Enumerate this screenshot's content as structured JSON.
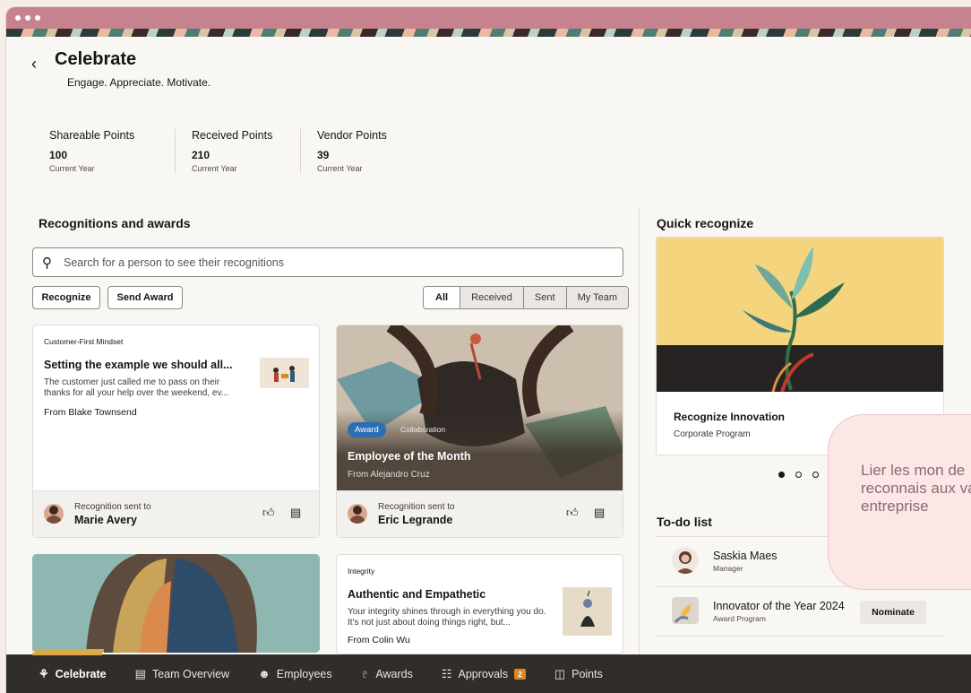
{
  "header": {
    "title": "Celebrate",
    "subtitle": "Engage. Appreciate. Motivate."
  },
  "points": [
    {
      "label": "Shareable Points",
      "value": "100",
      "period": "Current Year"
    },
    {
      "label": "Received Points",
      "value": "210",
      "period": "Current Year"
    },
    {
      "label": "Vendor Points",
      "value": "39",
      "period": "Current Year"
    }
  ],
  "recognitions": {
    "title": "Recognitions and awards",
    "search_placeholder": "Search for a person to see their recognitions",
    "recognize_label": "Recognize",
    "send_award_label": "Send Award",
    "filters": [
      "All",
      "Received",
      "Sent",
      "My Team"
    ],
    "cards": [
      {
        "tag": "Customer-First Mindset",
        "title": "Setting the example we should all...",
        "desc": "The customer just called me to pass on their thanks for all your help over the weekend, ev...",
        "from": "From Blake Townsend",
        "sent_label": "Recognition sent to",
        "recipient": "Marie Avery"
      },
      {
        "badge": "Award",
        "category": "Collaboration",
        "title": "Employee of the Month",
        "from": "From Alejandro Cruz",
        "sent_label": "Recognition sent to",
        "recipient": "Eric Legrande"
      },
      {
        "tag": "Integrity",
        "title": "Authentic and Empathetic",
        "desc": "Your integrity shines through in everything you do. It's not just about doing things right, but...",
        "from": "From Colin Wu"
      }
    ]
  },
  "quick_recognize": {
    "title": "Quick recognize",
    "card_title": "Recognize Innovation",
    "card_sub": "Corporate Program"
  },
  "todo": {
    "title": "To-do list",
    "items": [
      {
        "name": "Saskia Maes",
        "role": "Manager"
      },
      {
        "name": "Innovator of the Year 2024",
        "role": "Award Program",
        "action": "Nominate"
      }
    ]
  },
  "tooltip": {
    "text": "Lier les mon de reconnais aux valeurs entreprise"
  },
  "nav": {
    "items": [
      "Celebrate",
      "Team Overview",
      "Employees",
      "Awards",
      "Approvals",
      "Points"
    ],
    "approvals_count": "2"
  },
  "colors": {
    "titlebar": "#c6828f",
    "nav_bg": "#312d2a",
    "award_badge": "#2a6fb3",
    "approvals_badge": "#d98a1c"
  }
}
